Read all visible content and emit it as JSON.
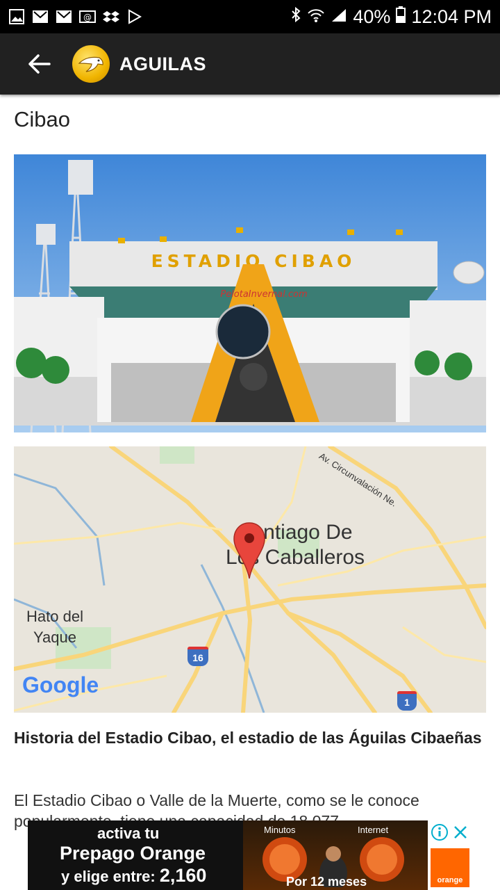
{
  "status_bar": {
    "battery": "40%",
    "time": "12:04 PM"
  },
  "toolbar": {
    "title": "AGUILAS"
  },
  "section": {
    "title": "Cibao"
  },
  "map": {
    "city_line1": "Santiago De",
    "city_line2": "Los Caballeros",
    "hato_line1": "Hato del",
    "hato_line2": "Yaque",
    "road_label": "Av. Circunvalación Ne.",
    "route16": "16",
    "route1": "1",
    "google": "Google"
  },
  "article": {
    "heading": "Historia del Estadio Cibao, el estadio de las Águilas Cibaeñas",
    "body": "El Estadio Cibao o Valle de la Muerte, como se le conoce popularmente, tiene una capacidad de 18,077"
  },
  "photo": {
    "sign": "ESTADIO CIBAO",
    "watermark": "PelotaInvernal.com"
  },
  "ad": {
    "line1": "activa tu",
    "line2": "Prepago Orange",
    "line3": "y elige entre:",
    "number": "2,160",
    "minutos": "Minutos",
    "internet": "Internet",
    "period": "Por 12 meses",
    "brand": "orange"
  },
  "colors": {
    "toolbar": "#212121",
    "logo_gold": "#f0b400",
    "map_bg": "#e9e5dc",
    "pin": "#e8453c"
  }
}
